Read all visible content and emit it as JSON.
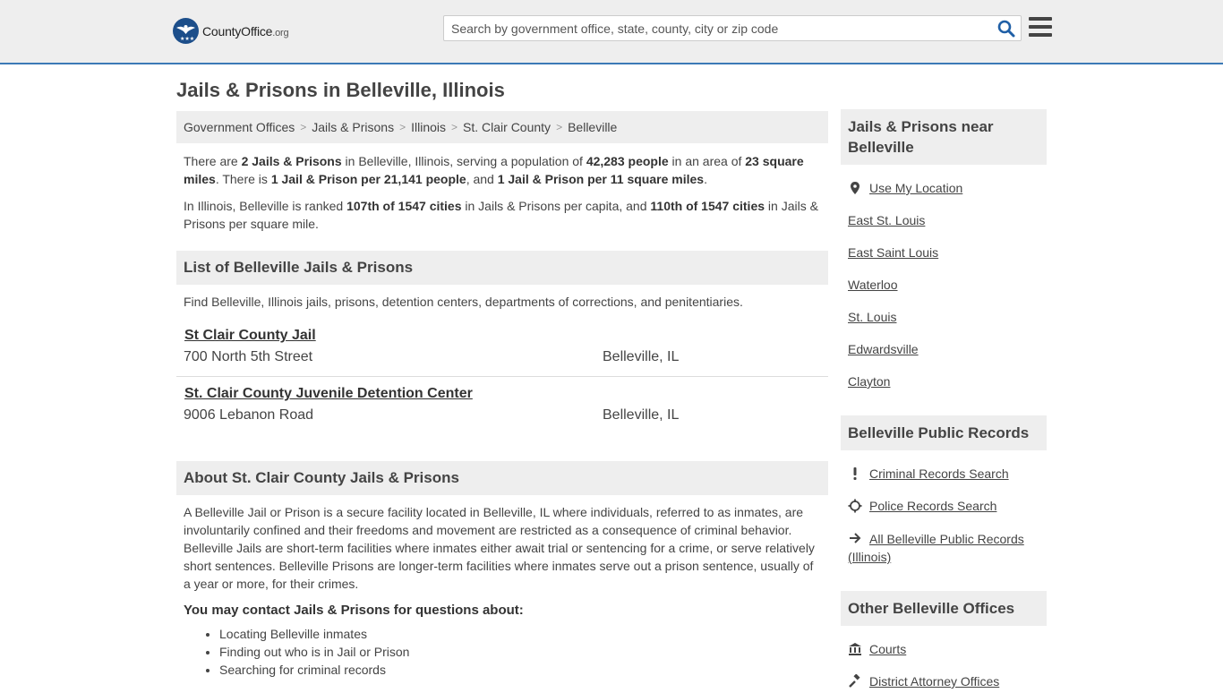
{
  "header": {
    "logo_main": "CountyOffice",
    "logo_tld": ".org",
    "search_placeholder": "Search by government office, state, county, city or zip code"
  },
  "page_title": "Jails & Prisons in Belleville, Illinois",
  "breadcrumb": [
    "Government Offices",
    "Jails & Prisons",
    "Illinois",
    "St. Clair County",
    "Belleville"
  ],
  "intro": {
    "p1": {
      "a": "There are ",
      "b": "2 Jails & Prisons",
      "c": " in Belleville, Illinois, serving a population of ",
      "d": "42,283 people",
      "e": " in an area of ",
      "f": "23 square miles",
      "g": ". There is ",
      "h": "1 Jail & Prison per 21,141 people",
      "i": ", and ",
      "j": "1 Jail & Prison per 11 square miles",
      "k": "."
    },
    "p2": {
      "a": "In Illinois, Belleville is ranked ",
      "b": "107th of 1547 cities",
      "c": " in Jails & Prisons per capita, and ",
      "d": "110th of 1547 cities",
      "e": " in Jails & Prisons per square mile."
    }
  },
  "list_section": {
    "heading": "List of Belleville Jails & Prisons",
    "description": "Find Belleville, Illinois jails, prisons, detention centers, departments of corrections, and penitentiaries.",
    "listings": [
      {
        "name": "St Clair County Jail",
        "address": "700 North 5th Street",
        "city": "Belleville, IL"
      },
      {
        "name": "St. Clair County Juvenile Detention Center",
        "address": "9006 Lebanon Road",
        "city": "Belleville, IL"
      }
    ]
  },
  "about_section": {
    "heading": "About St. Clair County Jails & Prisons",
    "body": "A Belleville Jail or Prison is a secure facility located in Belleville, IL where individuals, referred to as inmates, are involuntarily confined and their freedoms and movement are restricted as a consequence of criminal behavior. Belleville Jails are short-term facilities where inmates either await trial or sentencing for a crime, or serve relatively short sentences. Belleville Prisons are longer-term facilities where inmates serve out a prison sentence, usually of a year or more, for their crimes.",
    "contact_heading": "You may contact Jails & Prisons for questions about:",
    "bullets": [
      "Locating Belleville inmates",
      "Finding out who is in Jail or Prison",
      "Searching for criminal records"
    ]
  },
  "sidebar": {
    "near": {
      "heading": "Jails & Prisons near Belleville",
      "use_location": "Use My Location",
      "items": [
        "East St. Louis",
        "East Saint Louis",
        "Waterloo",
        "St. Louis",
        "Edwardsville",
        "Clayton"
      ]
    },
    "records": {
      "heading": "Belleville Public Records",
      "items": [
        "Criminal Records Search",
        "Police Records Search",
        "All Belleville Public Records (Illinois)"
      ]
    },
    "other": {
      "heading": "Other Belleville Offices",
      "items": [
        "Courts",
        "District Attorney Offices"
      ]
    }
  },
  "colors": {
    "accent": "#3c7ab6",
    "search_icon": "#1f5fa6",
    "logo": "#1c4e8a"
  }
}
